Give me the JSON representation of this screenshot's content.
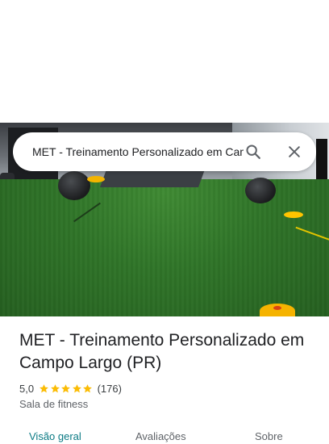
{
  "search": {
    "query": "MET - Treinamento Personalizado em Campo Largo (PR)"
  },
  "place": {
    "title": "MET - Treinamento Personalizado em Campo Largo (PR)",
    "rating": "5,0",
    "stars": 5,
    "review_count": "(176)",
    "category": "Sala de fitness"
  },
  "tabs": [
    {
      "label": "Visão geral",
      "active": true
    },
    {
      "label": "Avaliações",
      "active": false
    },
    {
      "label": "Sobre",
      "active": false
    }
  ],
  "icons": {
    "search": "search-icon",
    "close": "close-icon",
    "star": "star-icon"
  },
  "colors": {
    "star": "#fbbc04",
    "active_tab": "#0b7a84",
    "icon_gray": "#5f6368"
  }
}
